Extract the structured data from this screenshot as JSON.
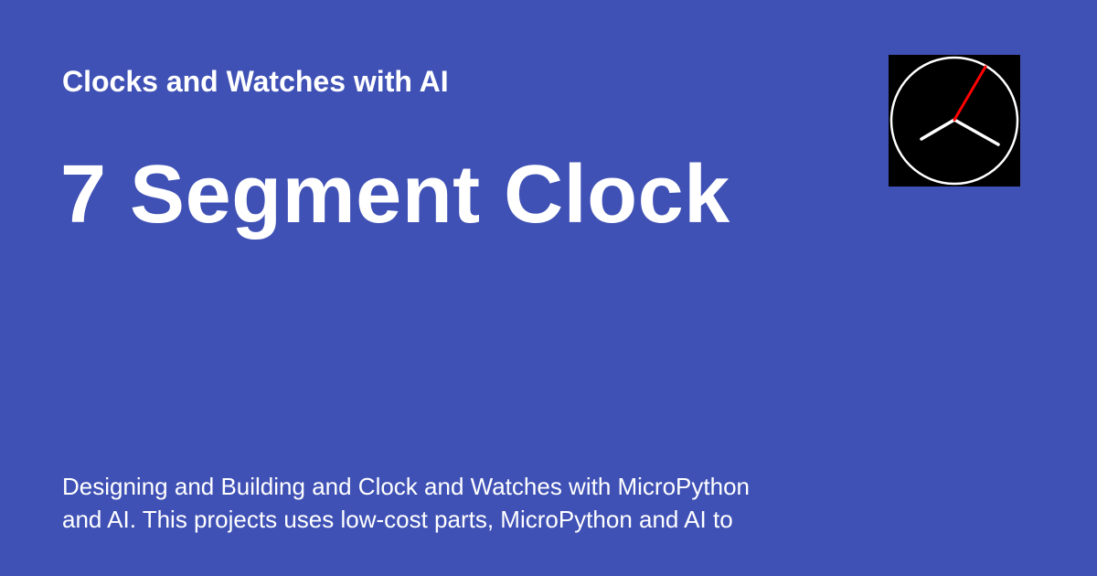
{
  "header": {
    "site_name": "Clocks and Watches with AI"
  },
  "page": {
    "title": "7 Segment Clock",
    "description_lines": [
      "Designing and Building and Clock and Watches with MicroPython",
      "and AI.  This projects uses low-cost parts, MicroPython and AI to"
    ]
  },
  "logo": {
    "icon": "analog-clock-icon",
    "colors": {
      "background": "#000000",
      "face_ring": "#ffffff",
      "hands": "#ffffff",
      "second_hand": "#ff0000"
    }
  },
  "theme": {
    "background": "#3f51b5",
    "text": "#ffffff"
  }
}
